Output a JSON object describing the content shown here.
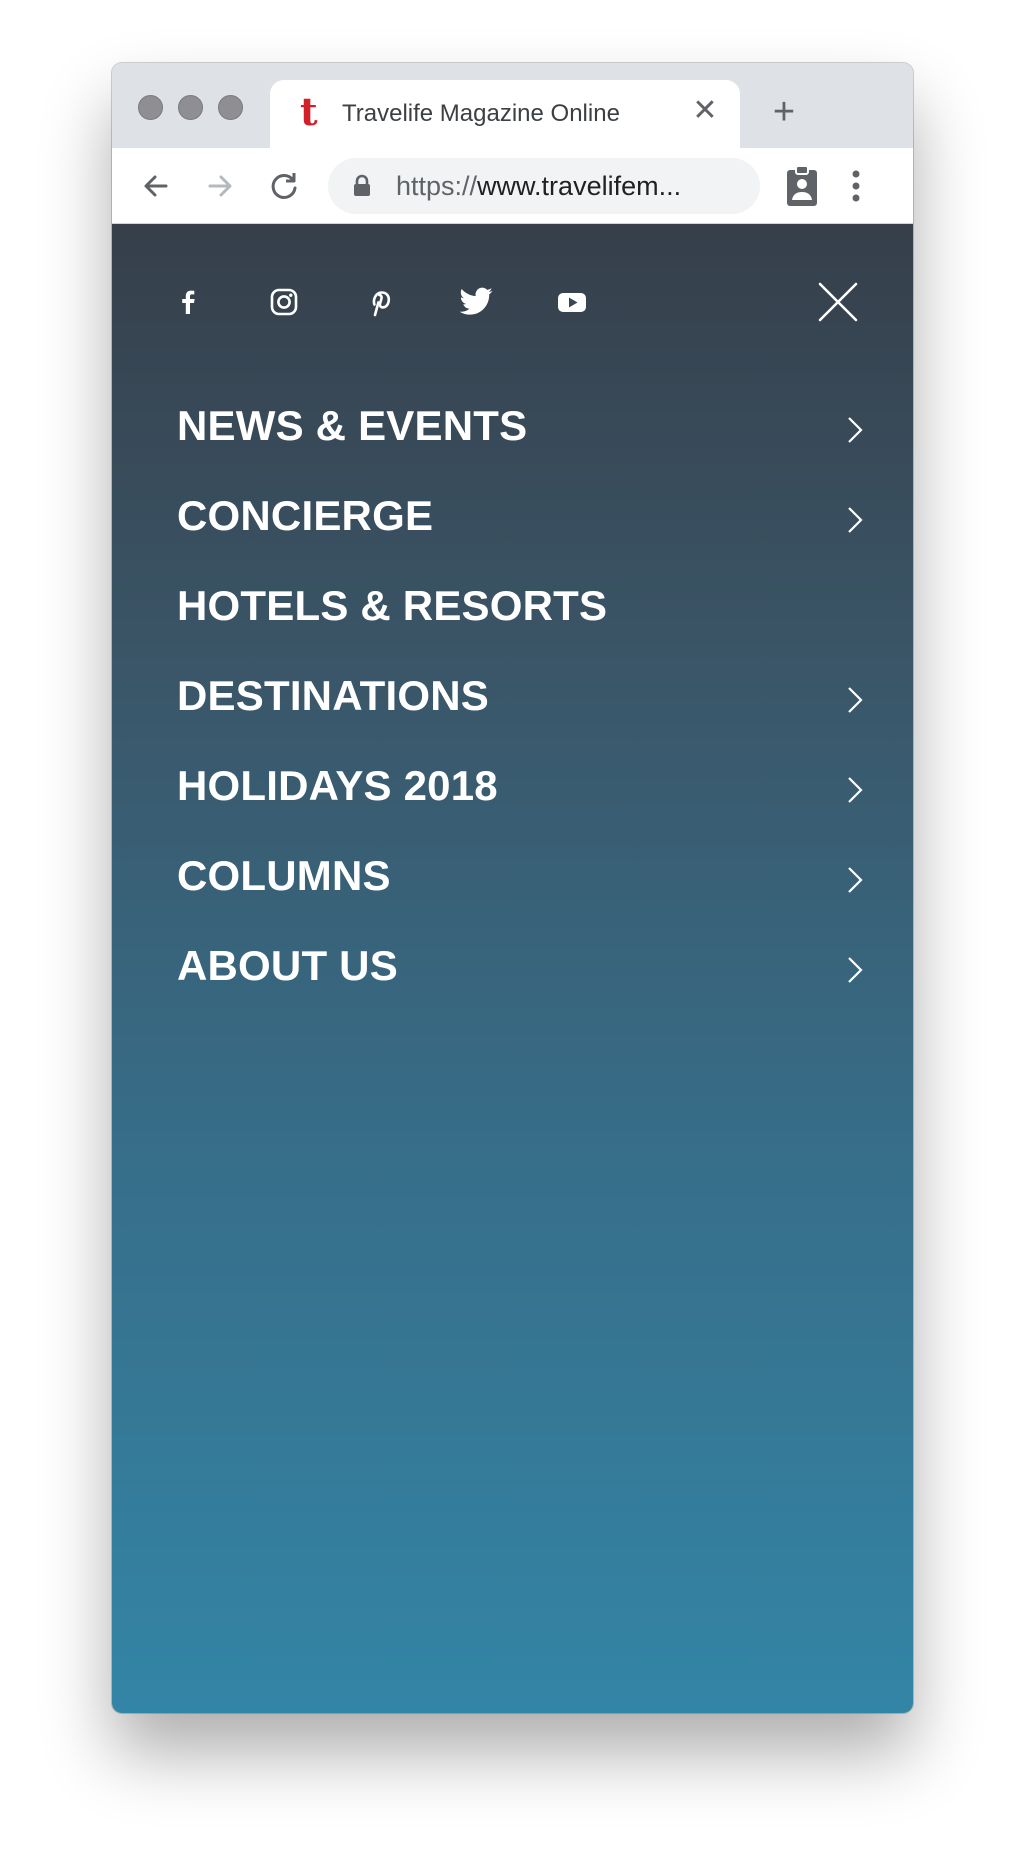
{
  "browser": {
    "tab": {
      "title": "Travelife Magazine Online",
      "favicon_letter": "t",
      "favicon_color": "#d0202a"
    },
    "url": {
      "scheme": "https://",
      "rest": "www.travelifem..."
    },
    "icons": [
      "back-arrow-icon",
      "forward-arrow-icon",
      "reload-icon",
      "lock-icon",
      "badge-icon",
      "kebab-menu-icon",
      "close-icon",
      "plus-icon"
    ]
  },
  "menu": {
    "social_icons": [
      "facebook-icon",
      "instagram-icon",
      "pinterest-icon",
      "twitter-icon",
      "youtube-icon"
    ],
    "items": [
      {
        "label": "NEWS & EVENTS",
        "has_submenu": true
      },
      {
        "label": "CONCIERGE",
        "has_submenu": true
      },
      {
        "label": "HOTELS & RESORTS",
        "has_submenu": false
      },
      {
        "label": "DESTINATIONS",
        "has_submenu": true
      },
      {
        "label": "HOLIDAYS 2018",
        "has_submenu": true
      },
      {
        "label": "COLUMNS",
        "has_submenu": true
      },
      {
        "label": "ABOUT US",
        "has_submenu": true
      }
    ],
    "gradient_top": "#363f4a",
    "gradient_bottom": "#3385a6"
  }
}
